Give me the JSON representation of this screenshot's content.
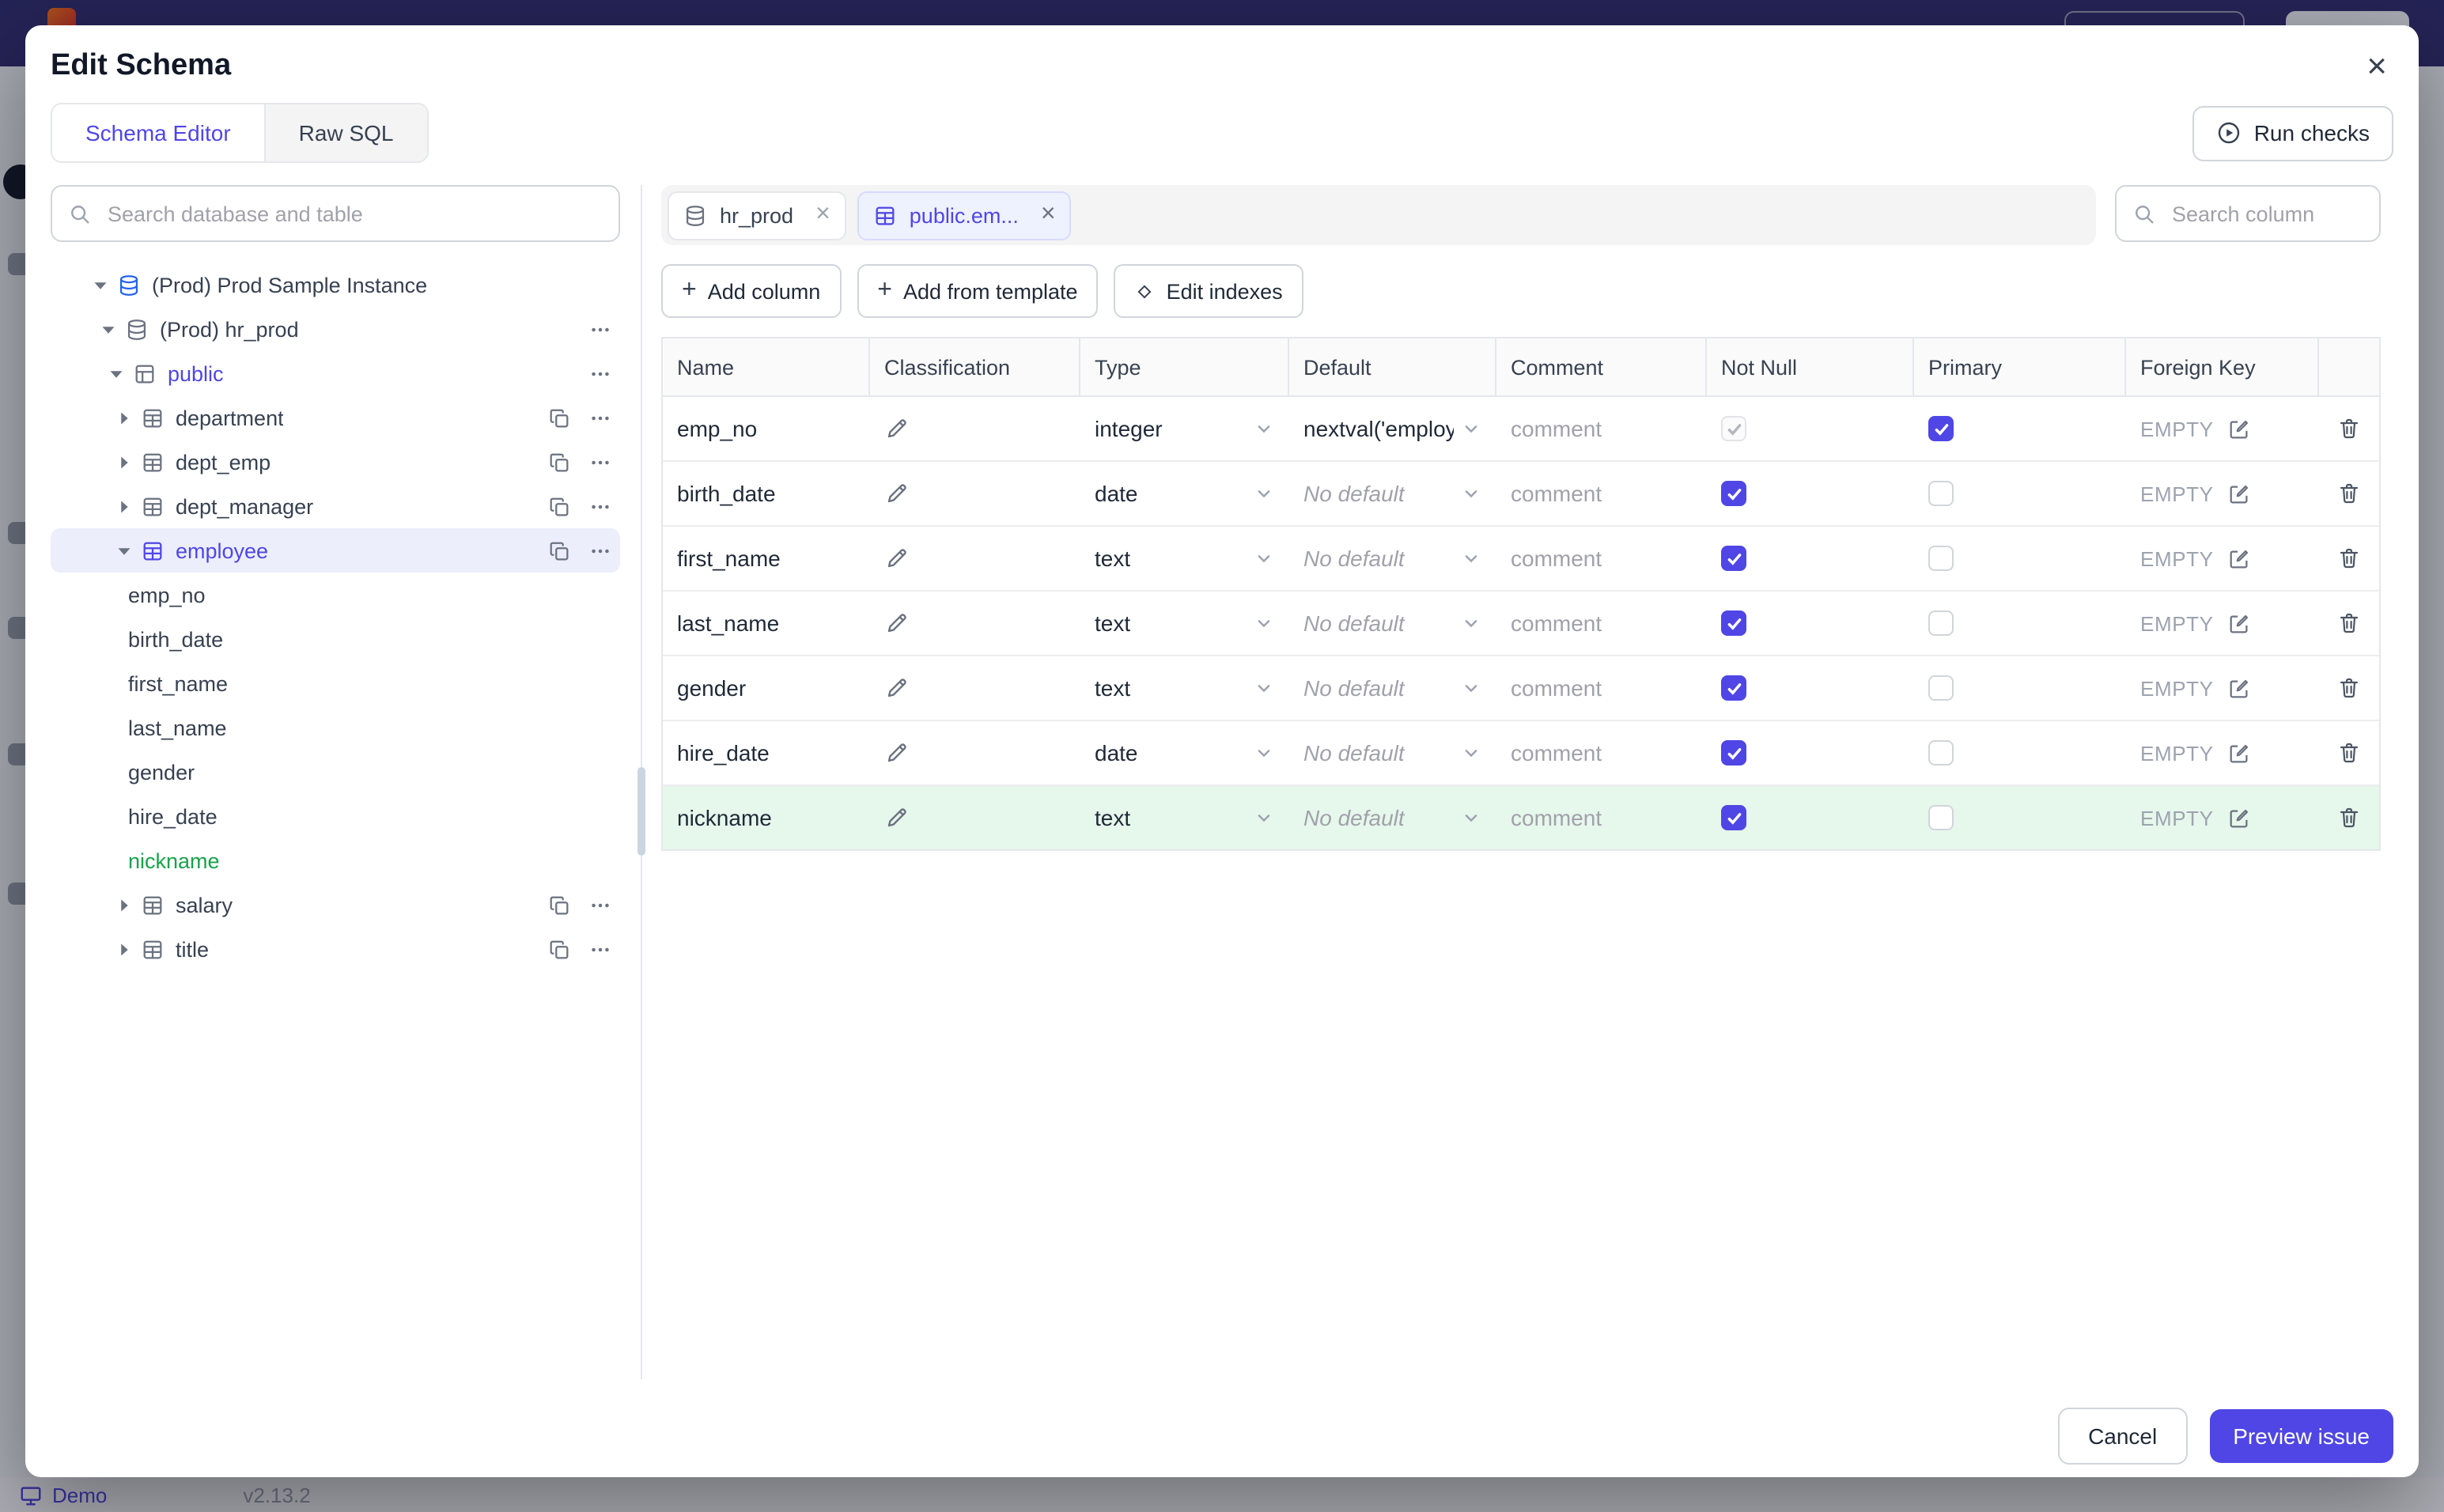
{
  "app": {
    "bottom_bar": {
      "demo_label": "Demo",
      "version": "v2.13.2"
    }
  },
  "modal": {
    "title": "Edit Schema",
    "close_glyph": "×",
    "tabs": [
      {
        "label": "Schema Editor",
        "active": true
      },
      {
        "label": "Raw SQL",
        "active": false
      }
    ],
    "run_checks_label": "Run checks",
    "tree": {
      "search_placeholder": "Search database and table",
      "items": [
        {
          "label": "(Prod) Prod Sample Instance",
          "depth": 0,
          "caret": "down",
          "icon": "instance"
        },
        {
          "label": "(Prod) hr_prod",
          "depth": 1,
          "caret": "down",
          "icon": "database",
          "actions": [
            "more"
          ]
        },
        {
          "label": "public",
          "depth": 2,
          "caret": "down",
          "icon": "schema",
          "accent": "#4f46e5",
          "actions": [
            "more"
          ]
        },
        {
          "label": "department",
          "depth": 3,
          "caret": "right",
          "icon": "table",
          "actions": [
            "copy",
            "more"
          ]
        },
        {
          "label": "dept_emp",
          "depth": 3,
          "caret": "right",
          "icon": "table",
          "actions": [
            "copy",
            "more"
          ]
        },
        {
          "label": "dept_manager",
          "depth": 3,
          "caret": "right",
          "icon": "table",
          "actions": [
            "copy",
            "more"
          ]
        },
        {
          "label": "employee",
          "depth": 3,
          "caret": "down",
          "icon": "table",
          "selected": true,
          "accent": "#4f46e5",
          "actions": [
            "copy",
            "more"
          ]
        },
        {
          "label": "emp_no",
          "column": true
        },
        {
          "label": "birth_date",
          "column": true
        },
        {
          "label": "first_name",
          "column": true
        },
        {
          "label": "last_name",
          "column": true
        },
        {
          "label": "gender",
          "column": true
        },
        {
          "label": "hire_date",
          "column": true
        },
        {
          "label": "nickname",
          "column": true,
          "accent": "#16a34a"
        },
        {
          "label": "salary",
          "depth": 3,
          "caret": "right",
          "icon": "table",
          "actions": [
            "copy",
            "more"
          ]
        },
        {
          "label": "title",
          "depth": 3,
          "caret": "right",
          "icon": "table",
          "actions": [
            "copy",
            "more"
          ]
        }
      ]
    },
    "editor": {
      "chips": [
        {
          "label": "hr_prod",
          "icon": "database-icon",
          "active": false
        },
        {
          "label": "public.em...",
          "icon": "table-icon",
          "active": true
        }
      ],
      "column_search_placeholder": "Search column",
      "toolbar": {
        "add_column": "Add column",
        "add_from_template": "Add from template",
        "edit_indexes": "Edit indexes"
      },
      "table": {
        "headers": [
          "Name",
          "Classification",
          "Type",
          "Default",
          "Comment",
          "Not Null",
          "Primary",
          "Foreign Key"
        ],
        "rows": [
          {
            "name": "emp_no",
            "type": "integer",
            "default": "nextval('employ",
            "default_placeholder": false,
            "comment": "comment",
            "not_null": "checked-disabled",
            "primary": "checked",
            "foreign_key": "EMPTY",
            "highlight": false
          },
          {
            "name": "birth_date",
            "type": "date",
            "default": "No default",
            "default_placeholder": true,
            "comment": "comment",
            "not_null": "checked",
            "primary": "unchecked",
            "foreign_key": "EMPTY",
            "highlight": false
          },
          {
            "name": "first_name",
            "type": "text",
            "default": "No default",
            "default_placeholder": true,
            "comment": "comment",
            "not_null": "checked",
            "primary": "unchecked",
            "foreign_key": "EMPTY",
            "highlight": false
          },
          {
            "name": "last_name",
            "type": "text",
            "default": "No default",
            "default_placeholder": true,
            "comment": "comment",
            "not_null": "checked",
            "primary": "unchecked",
            "foreign_key": "EMPTY",
            "highlight": false
          },
          {
            "name": "gender",
            "type": "text",
            "default": "No default",
            "default_placeholder": true,
            "comment": "comment",
            "not_null": "checked",
            "primary": "unchecked",
            "foreign_key": "EMPTY",
            "highlight": false
          },
          {
            "name": "hire_date",
            "type": "date",
            "default": "No default",
            "default_placeholder": true,
            "comment": "comment",
            "not_null": "checked",
            "primary": "unchecked",
            "foreign_key": "EMPTY",
            "highlight": false
          },
          {
            "name": "nickname",
            "type": "text",
            "default": "No default",
            "default_placeholder": true,
            "comment": "comment",
            "not_null": "checked",
            "primary": "unchecked",
            "foreign_key": "EMPTY",
            "highlight": true
          }
        ]
      }
    },
    "footer": {
      "cancel_label": "Cancel",
      "preview_label": "Preview issue"
    }
  },
  "colors": {
    "accent": "#4f46e5",
    "selected_tree_row_bg": "#eceefc",
    "new_column_green": "#16a34a",
    "new_row_bg": "#e6f7ec",
    "checkbox_checked": "#4f46e5",
    "topbar": "#2e2b6e"
  }
}
